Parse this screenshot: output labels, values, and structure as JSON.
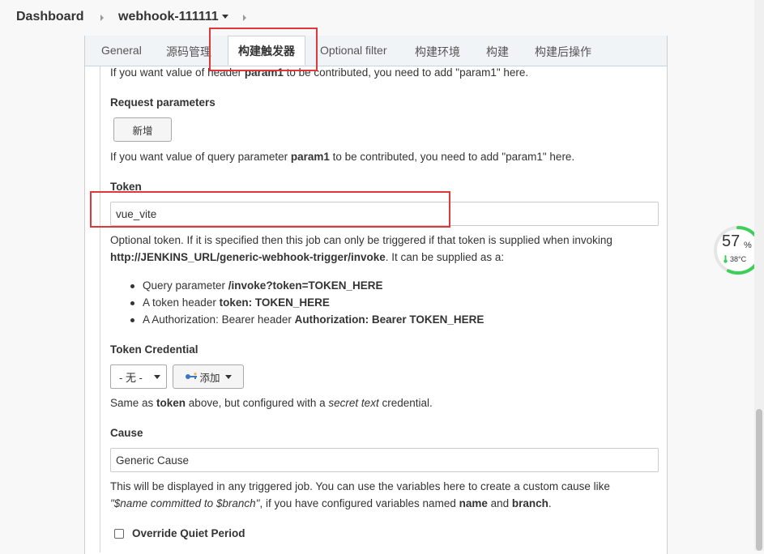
{
  "breadcrumb": {
    "dashboard": "Dashboard",
    "job": "webhook-111111"
  },
  "tabs": [
    {
      "label": "General"
    },
    {
      "label": "源码管理"
    },
    {
      "label": "构建触发器"
    },
    {
      "label": "Optional filter"
    },
    {
      "label": "构建环境"
    },
    {
      "label": "构建"
    },
    {
      "label": "构建后操作"
    }
  ],
  "header_help": {
    "pre": "If you want value of header ",
    "bold": "param1",
    "post": " to be contributed, you need to add \"param1\" here."
  },
  "request_params": {
    "label": "Request parameters",
    "add_button": "新增",
    "help_pre": "If you want value of query parameter ",
    "help_bold": "param1",
    "help_post": " to be contributed, you need to add \"param1\" here."
  },
  "token": {
    "label": "Token",
    "value": "vue_vite",
    "help_line1": "Optional token. If it is specified then this job can only be triggered if that token is supplied when invoking",
    "help_url": "http://JENKINS_URL/generic-webhook-trigger/invoke",
    "help_line2_post": ". It can be supplied as a:",
    "bullets": [
      {
        "pre": "Query parameter ",
        "bold": "/invoke?token=",
        "post": "TOKEN_HERE"
      },
      {
        "pre": "A token header ",
        "bold": "token: TOKEN_HERE",
        "post": ""
      },
      {
        "pre": "A Authorization: Bearer header ",
        "bold": "Authorization: Bearer TOKEN_HERE",
        "post": ""
      }
    ]
  },
  "token_credential": {
    "label": "Token Credential",
    "select_value": "- 无 -",
    "add_button": "添加",
    "help_pre": "Same as ",
    "help_bold": "token",
    "help_mid": " above, but configured with a ",
    "help_italic": "secret text",
    "help_post": " credential."
  },
  "cause": {
    "label": "Cause",
    "value": "Generic Cause",
    "help_line1": "This will be displayed in any triggered job. You can use the variables here to create a custom cause like",
    "help_line2_italic": "\"$name committed to $branch\"",
    "help_line2_mid": ", if you have configured variables named ",
    "help_line2_bold1": "name",
    "help_line2_and": " and ",
    "help_line2_bold2": "branch",
    "help_line2_end": "."
  },
  "quiet_period": {
    "label": "Override Quiet Period"
  },
  "widget": {
    "value": "57",
    "unit": "%",
    "temperature": "38°C",
    "progress": 0.57
  },
  "colors": {
    "highlight": "#e0383a",
    "gauge": "#3ecf5a"
  }
}
